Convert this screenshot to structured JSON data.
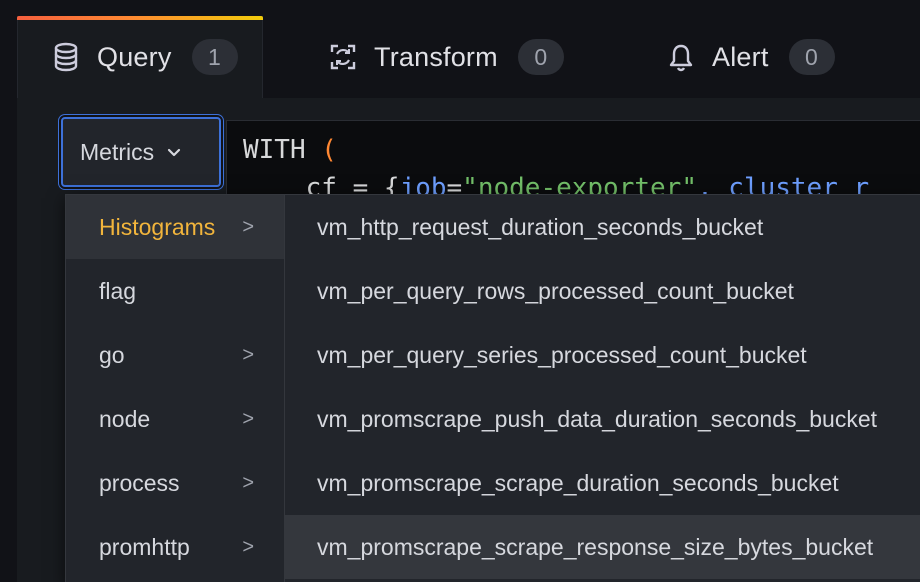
{
  "tabs": [
    {
      "label": "Query",
      "count": "1",
      "icon": "database-icon"
    },
    {
      "label": "Transform",
      "count": "0",
      "icon": "transform-icon"
    },
    {
      "label": "Alert",
      "count": "0",
      "icon": "bell-icon"
    }
  ],
  "datasource_picker": {
    "label": "Metrics",
    "icon": "chevron-down-icon"
  },
  "editor": {
    "keyword": "WITH",
    "open_paren": "(",
    "line2_prefix": "    cf = {",
    "line2_key": "job",
    "line2_eq": "=",
    "line2_value": "\"node-exporter\"",
    "line2_rest": ", cluster_r"
  },
  "cascader": {
    "categories": [
      {
        "label": "Histograms",
        "has_children": true,
        "selected": true
      },
      {
        "label": "flag",
        "has_children": false
      },
      {
        "label": "go",
        "has_children": true
      },
      {
        "label": "node",
        "has_children": true
      },
      {
        "label": "process",
        "has_children": true
      },
      {
        "label": "promhttp",
        "has_children": true
      }
    ],
    "arrow": ">",
    "metrics": [
      {
        "label": "vm_http_request_duration_seconds_bucket"
      },
      {
        "label": "vm_per_query_rows_processed_count_bucket"
      },
      {
        "label": "vm_per_query_series_processed_count_bucket"
      },
      {
        "label": "vm_promscrape_push_data_duration_seconds_bucket"
      },
      {
        "label": "vm_promscrape_scrape_duration_seconds_bucket"
      },
      {
        "label": "vm_promscrape_scrape_response_size_bytes_bucket",
        "hovered": true
      }
    ]
  },
  "colors": {
    "accent_selected": "#f2b53c",
    "focus_border": "#3d71d9",
    "tab_gradient_start": "#f55f3e",
    "tab_gradient_end": "#f2cc0c"
  }
}
